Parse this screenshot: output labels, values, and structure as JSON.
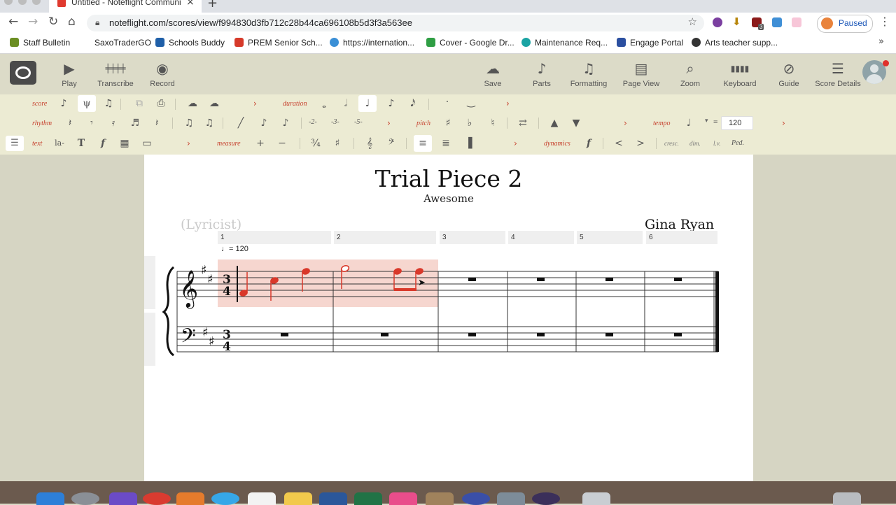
{
  "browser": {
    "tab_title": "Untitled - Noteflight Communi",
    "url": "noteflight.com/scores/view/f994830d3fb712c28b44ca696108b5d3f3a563ee",
    "profile_label": "Paused",
    "extension_badge": "3"
  },
  "bookmarks": [
    {
      "label": "Staff Bulletin",
      "color": "#6b8e23"
    },
    {
      "label": "SaxoTraderGO",
      "color": "#ffffff"
    },
    {
      "label": "Schools Buddy",
      "color": "#1f5fa8"
    },
    {
      "label": "PREM Senior Sch...",
      "color": "#d63a2a"
    },
    {
      "label": "https://internation...",
      "color": "#3a8fd6"
    },
    {
      "label": "Cover - Google Dr...",
      "color": "#2f9e44"
    },
    {
      "label": "Maintenance Req...",
      "color": "#1aa3a3"
    },
    {
      "label": "Engage Portal",
      "color": "#2b4fa0"
    },
    {
      "label": "Arts teacher supp...",
      "color": "#333333"
    }
  ],
  "toolbar_left": [
    {
      "label": "Play",
      "icon": "play-icon"
    },
    {
      "label": "Transcribe",
      "icon": "keyboard-transcribe-icon"
    },
    {
      "label": "Record",
      "icon": "record-icon"
    }
  ],
  "toolbar_right": [
    {
      "label": "Save",
      "icon": "cloud-save-icon"
    },
    {
      "label": "Parts",
      "icon": "guitar-icon"
    },
    {
      "label": "Formatting",
      "icon": "note-page-icon"
    },
    {
      "label": "Page View",
      "icon": "page-icon"
    },
    {
      "label": "Zoom",
      "icon": "zoom-icon"
    },
    {
      "label": "Keyboard",
      "icon": "keyboard-icon"
    },
    {
      "label": "Guide",
      "icon": "compass-icon"
    },
    {
      "label": "Score Details",
      "icon": "list-icon"
    }
  ],
  "palette": {
    "score": "score",
    "duration": "duration",
    "rhythm": "rhythm",
    "pitch": "pitch",
    "tempo": "tempo",
    "tempo_value": "120",
    "text": "text",
    "measure": "measure",
    "dynamics": "dynamics",
    "tuplets": [
      "-2-",
      "-3-",
      "-5-"
    ],
    "text_tools": [
      "la-",
      "T",
      "f"
    ],
    "dyn_tools": [
      "f",
      "cresc.",
      "dim.",
      "l.v.",
      "Ped."
    ],
    "accent_color": "#c6402d"
  },
  "score": {
    "title": "Trial Piece 2",
    "subtitle": "Awesome",
    "lyricist": "(Lyricist)",
    "composer": "Gina Ryan",
    "tempo_mark": "= 120",
    "measure_numbers": [
      "1",
      "2",
      "3",
      "4",
      "5",
      "6"
    ],
    "time_signature": {
      "top": "3",
      "bottom": "4"
    },
    "key": "D major (2 sharps)",
    "selection_color": "#f6d6cf",
    "note_color": "#d9382a"
  }
}
